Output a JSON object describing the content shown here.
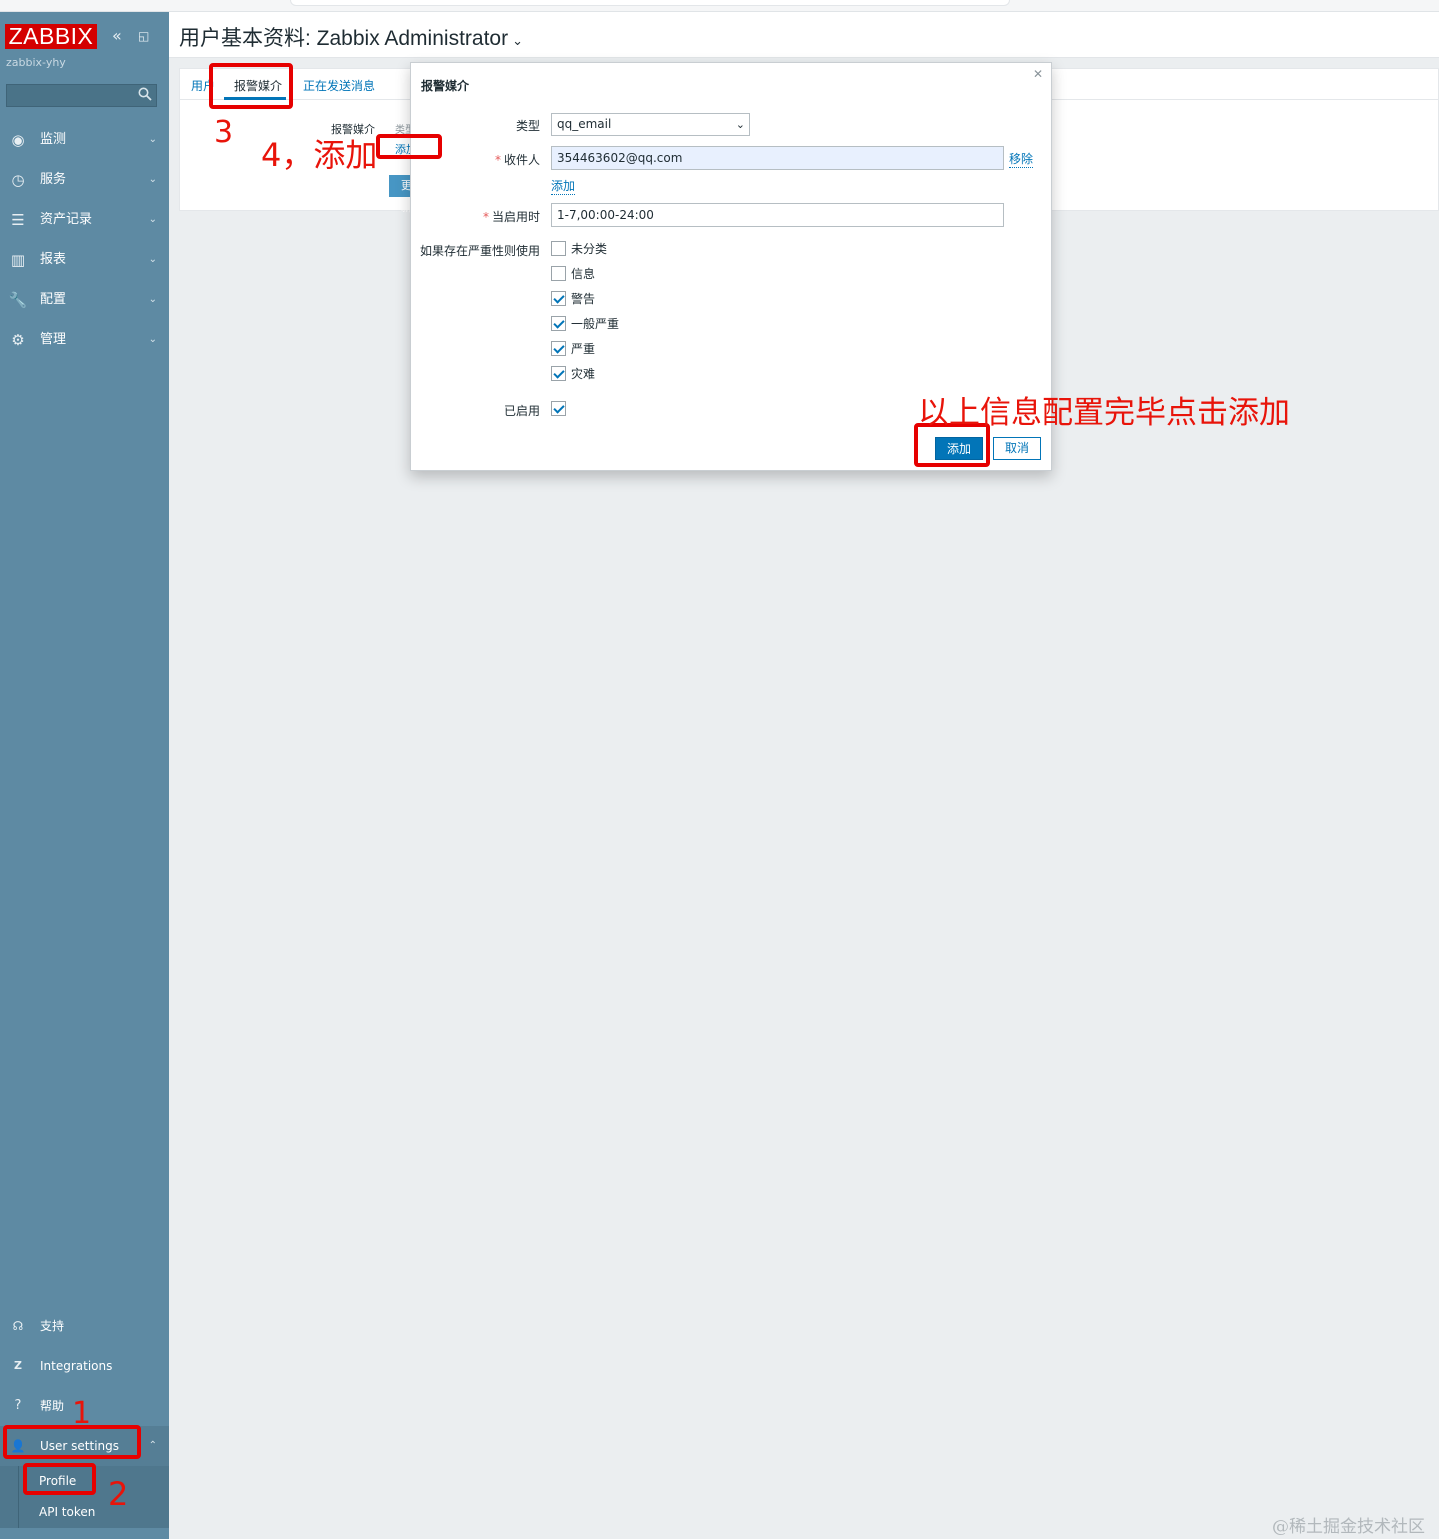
{
  "sidebar": {
    "logo": "ZABBIX",
    "server_name": "zabbix-yhy",
    "menu": [
      {
        "label": "监测",
        "icon": "eye-icon"
      },
      {
        "label": "服务",
        "icon": "clock-icon"
      },
      {
        "label": "资产记录",
        "icon": "list-icon"
      },
      {
        "label": "报表",
        "icon": "bar-chart-icon"
      },
      {
        "label": "配置",
        "icon": "wrench-icon"
      },
      {
        "label": "管理",
        "icon": "gear-icon"
      }
    ],
    "bottom": [
      {
        "label": "支持",
        "icon": "headset-icon"
      },
      {
        "label": "Integrations",
        "icon": "integrations-icon"
      },
      {
        "label": "帮助",
        "icon": "help-icon"
      },
      {
        "label": "User settings",
        "icon": "user-icon"
      }
    ],
    "submenu": [
      "Profile",
      "API token"
    ]
  },
  "header": {
    "title": "用户基本资料: Zabbix Administrator"
  },
  "tabs": [
    "用户",
    "报警媒介",
    "正在发送消息"
  ],
  "media_tab": {
    "label": "报警媒介",
    "type_header": "类型",
    "add": "添加",
    "update": "更新"
  },
  "modal": {
    "title": "报警媒介",
    "type_label": "类型",
    "type_value": "qq_email",
    "recipient_label": "收件人",
    "recipient_value": "354463602@qq.com",
    "remove": "移除",
    "add_link": "添加",
    "period_label": "当启用时",
    "period_value": "1-7,00:00-24:00",
    "severity_label": "如果存在严重性则使用",
    "severities": [
      {
        "label": "未分类",
        "checked": false
      },
      {
        "label": "信息",
        "checked": false
      },
      {
        "label": "警告",
        "checked": true
      },
      {
        "label": "一般严重",
        "checked": true
      },
      {
        "label": "严重",
        "checked": true
      },
      {
        "label": "灾难",
        "checked": true
      }
    ],
    "enabled_label": "已启用",
    "enabled": true,
    "add_button": "添加",
    "cancel_button": "取消"
  },
  "annotations": {
    "n1": "1",
    "n2": "2",
    "n3": "3",
    "n4": "4，添加",
    "note": "以上信息配置完毕点击添加"
  },
  "watermark": "@稀土掘金技术社区",
  "colors": {
    "sidebar": "#5e8aa3",
    "accent": "#0275b8",
    "annotation": "#e60000",
    "logo": "#d40000"
  }
}
